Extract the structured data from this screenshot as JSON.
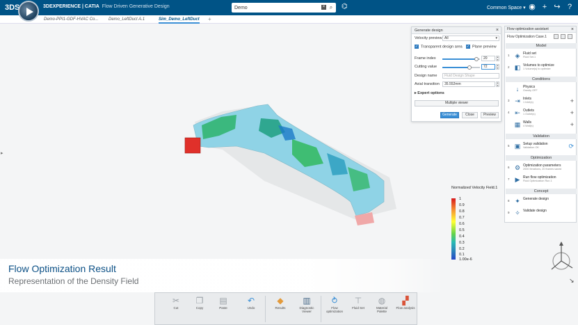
{
  "topbar": {
    "logo": "3DS",
    "brand_a": "3DEXPERIENCE | CATIA",
    "brand_b": "Flow Driven Generative Design",
    "search_value": "Demo",
    "space_label": "Common Space"
  },
  "tabs": [
    {
      "label": "Demo-PPI1-GDF-HVAC Co..."
    },
    {
      "label": "Demo_LeftDuct A.1"
    },
    {
      "label": "Sim_Demo_LeftDuct"
    }
  ],
  "generate_design": {
    "title": "Generate design",
    "velocity_preview_label": "Velocity preview",
    "velocity_preview_value": "All",
    "transparent_label": "Transparent design area",
    "plane_label": "Plane preview",
    "frame_index_label": "Frame index",
    "frame_index_value": "20",
    "frame_fraction": 0.9,
    "cutting_value_label": "Cutting value",
    "cutting_value_value": "72",
    "cutting_fraction": 0.72,
    "design_name_label": "Design name",
    "design_name_placeholder": "Fluid Design Shape",
    "axial_label": "Axial transition",
    "axial_value": "35.552mm",
    "expert_label": "Expert options",
    "multiple_viewer": "Multiple viewer",
    "generate": "Generate",
    "close": "Close",
    "preview": "Preview"
  },
  "assistant": {
    "title": "Flow optimization assistant",
    "case": "Flow Optimization Case.1",
    "sections": {
      "model": "Model",
      "conditions": "Conditions",
      "validation": "Validation",
      "optimization": "Optimization",
      "concept": "Concept"
    },
    "items": [
      {
        "num": "1",
        "label": "Fluid set",
        "sub": "Fluid Set.1"
      },
      {
        "num": "2",
        "label": "Volumes to optimize",
        "sub": "1 Volume(s) to optimize"
      },
      {
        "num": "",
        "label": "Physics",
        "sub": "Gravity OFF"
      },
      {
        "num": "3",
        "label": "Inlets",
        "sub": "1 Inlet(s)"
      },
      {
        "num": "4",
        "label": "Outlets",
        "sub": "1 Outlet(s)"
      },
      {
        "num": "",
        "label": "Walls",
        "sub": "4 Wall(s)"
      },
      {
        "num": "5",
        "label": "Setup validation",
        "sub": "Validation OK"
      },
      {
        "num": "6",
        "label": "Optimization parameters",
        "sub": "2000 Iterations, 20 frames saved"
      },
      {
        "num": "7",
        "label": "Run flow optimization",
        "sub": "Fluid Optimization Run.1"
      },
      {
        "num": "8",
        "label": "Generate design",
        "sub": ""
      },
      {
        "num": "9",
        "label": "Validate design",
        "sub": ""
      }
    ]
  },
  "legend": {
    "title": "Normalized Velocity Field.1",
    "labels": [
      "1",
      "0.9",
      "0.8",
      "0.7",
      "0.6",
      "0.5",
      "0.4",
      "0.3",
      "0.2",
      "0.1",
      "1.00e-6"
    ]
  },
  "banner": {
    "title": "Flow Optimization Result",
    "subtitle": "Representation of the Density Field"
  },
  "toolbar": [
    {
      "label": "Cut"
    },
    {
      "label": "Copy"
    },
    {
      "label": "Paste"
    },
    {
      "label": "Undo"
    },
    {
      "label": "Results"
    },
    {
      "label": "Diagnostic Viewer"
    },
    {
      "label": "Flow optimization"
    },
    {
      "label": "Fluid Set"
    },
    {
      "label": "Material Palette"
    },
    {
      "label": "Flow analysis"
    }
  ],
  "colors": {
    "topbar": "#005386",
    "accent": "#3a8fd6",
    "duct": "#8fd3e6",
    "inlet": "#e0302a"
  }
}
